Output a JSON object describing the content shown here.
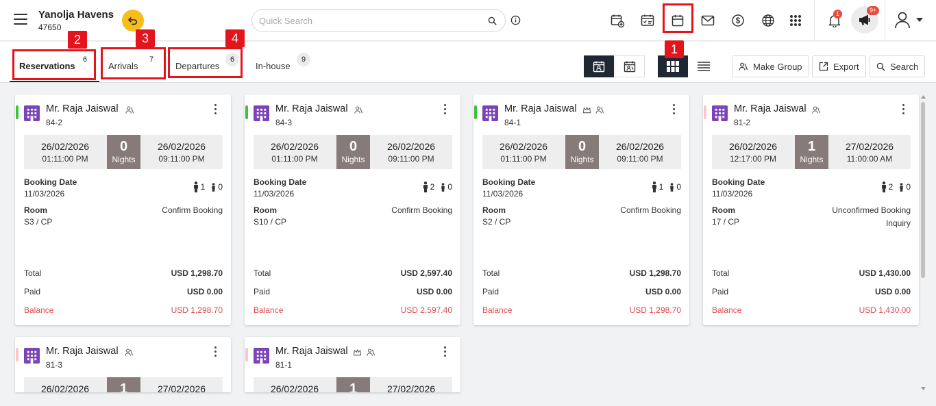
{
  "header": {
    "hotel_name": "Yanolja Havens",
    "hotel_id": "47650",
    "search_placeholder": "Quick Search",
    "notifications_badge": "1",
    "announcements_badge": "9+"
  },
  "tabs": [
    {
      "label": "Reservations",
      "count": "6"
    },
    {
      "label": "Arrivals",
      "count": "7"
    },
    {
      "label": "Departures",
      "count": "6"
    },
    {
      "label": "In-house",
      "count": "9"
    }
  ],
  "actions": {
    "make_group": "Make Group",
    "export": "Export",
    "search": "Search"
  },
  "annotations": [
    "1",
    "2",
    "3",
    "4"
  ],
  "labels": {
    "nights": "Nights",
    "booking_date": "Booking Date",
    "room": "Room",
    "total": "Total",
    "paid": "Paid",
    "balance": "Balance"
  },
  "cards": [
    {
      "name": "Mr. Raja Jaiswal",
      "id": "84-2",
      "bar_color": "#3bc43b",
      "crown": false,
      "arrival_date": "26/02/2026",
      "arrival_time": "01:11:00 PM",
      "nights": "0",
      "departure_date": "26/02/2026",
      "departure_time": "09:11:00 PM",
      "booking_date": "11/03/2026",
      "adults": "1",
      "children": "0",
      "room": "S3 / CP",
      "status": "Confirm Booking",
      "status2": "",
      "total": "USD 1,298.70",
      "paid": "USD 0.00",
      "balance": "USD 1,298.70"
    },
    {
      "name": "Mr. Raja Jaiswal",
      "id": "84-3",
      "bar_color": "#3bc43b",
      "crown": false,
      "arrival_date": "26/02/2026",
      "arrival_time": "01:11:00 PM",
      "nights": "0",
      "departure_date": "26/02/2026",
      "departure_time": "09:11:00 PM",
      "booking_date": "11/03/2026",
      "adults": "2",
      "children": "0",
      "room": "S10 / CP",
      "status": "Confirm Booking",
      "status2": "",
      "total": "USD 2,597.40",
      "paid": "USD 0.00",
      "balance": "USD 2,597.40"
    },
    {
      "name": "Mr. Raja Jaiswal",
      "id": "84-1",
      "bar_color": "#3bc43b",
      "crown": true,
      "arrival_date": "26/02/2026",
      "arrival_time": "01:11:00 PM",
      "nights": "0",
      "departure_date": "26/02/2026",
      "departure_time": "09:11:00 PM",
      "booking_date": "11/03/2026",
      "adults": "1",
      "children": "0",
      "room": "S2 / CP",
      "status": "Confirm Booking",
      "status2": "",
      "total": "USD 1,298.70",
      "paid": "USD 0.00",
      "balance": "USD 1,298.70"
    },
    {
      "name": "Mr. Raja Jaiswal",
      "id": "81-2",
      "bar_color": "#f7c7cb",
      "crown": false,
      "arrival_date": "26/02/2026",
      "arrival_time": "12:17:00 PM",
      "nights": "1",
      "departure_date": "27/02/2026",
      "departure_time": "11:00:00 AM",
      "booking_date": "11/03/2026",
      "adults": "2",
      "children": "0",
      "room": "17 / CP",
      "status": "Unconfirmed Booking",
      "status2": "Inquiry",
      "total": "USD 1,430.00",
      "paid": "USD 0.00",
      "balance": "USD 1,430.00"
    },
    {
      "name": "Mr. Raja Jaiswal",
      "id": "81-3",
      "bar_color": "#f7c7cb",
      "crown": false,
      "arrival_date": "26/02/2026",
      "nights": "1",
      "departure_date": "27/02/2026"
    },
    {
      "name": "Mr. Raja Jaiswal",
      "id": "81-1",
      "bar_color": "#f7c7cb",
      "crown": true,
      "arrival_date": "26/02/2026",
      "nights": "1",
      "departure_date": "27/02/2026"
    }
  ],
  "colors": {
    "accent": "#1f2733",
    "balance": "#e04b4b",
    "highlight": "#e3141c",
    "hotel_icon": "#7a44b7"
  }
}
